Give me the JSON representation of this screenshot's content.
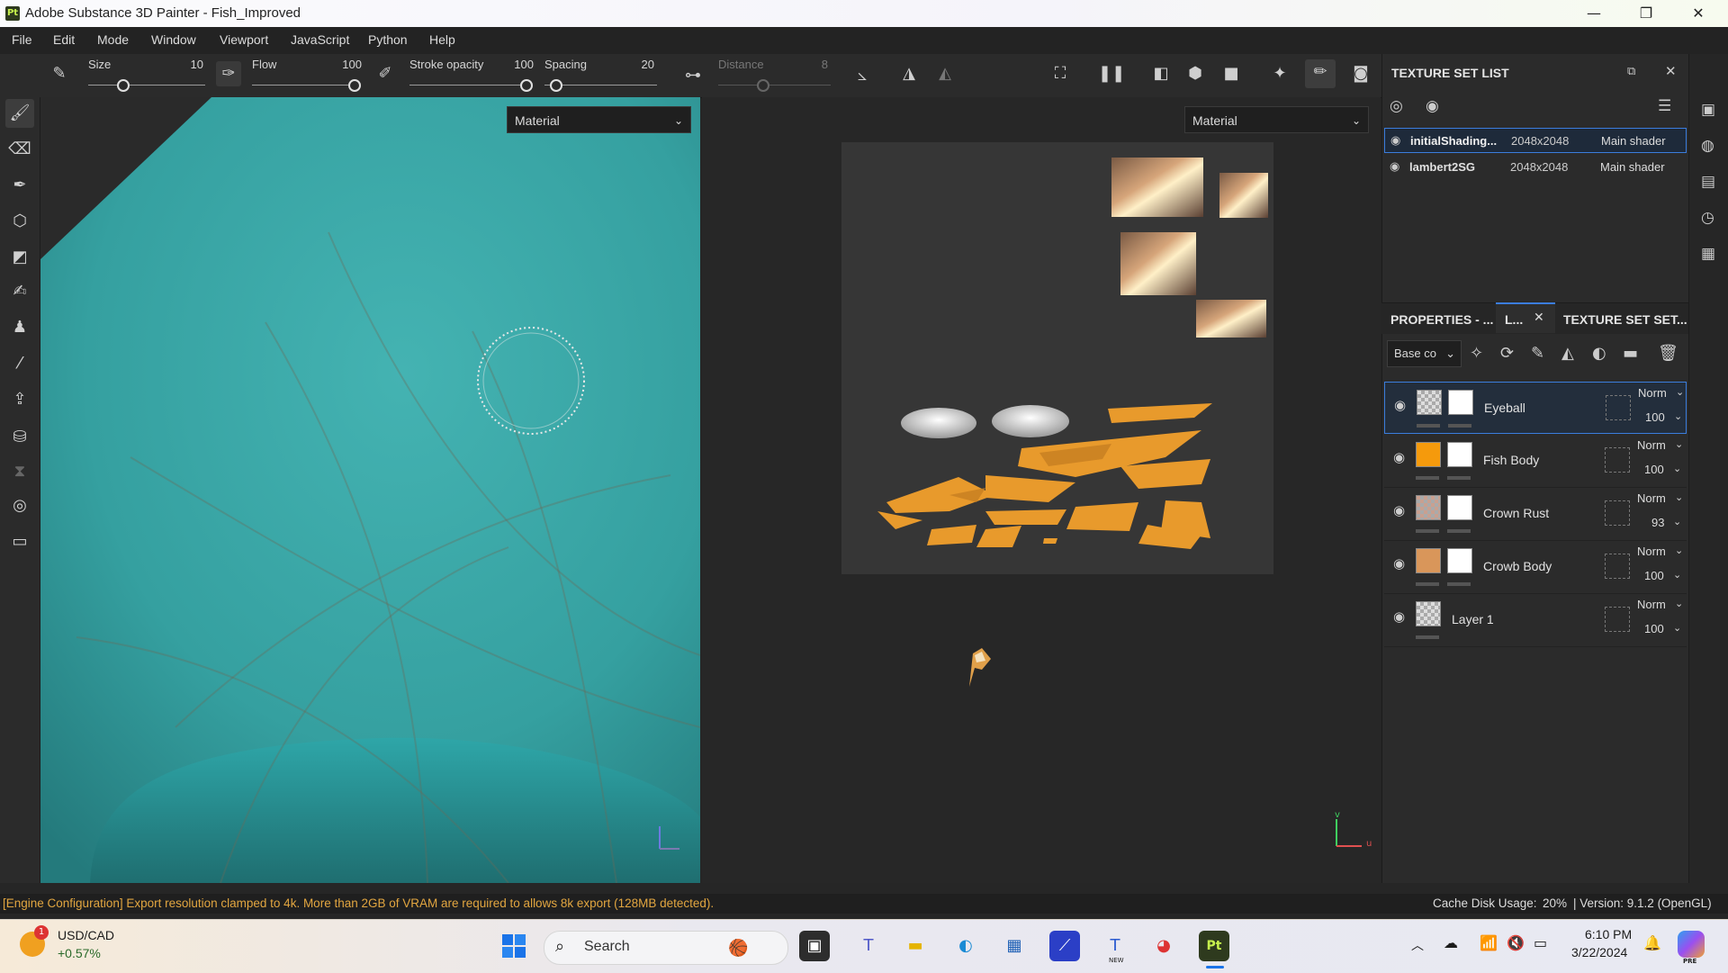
{
  "window": {
    "title": "Adobe Substance 3D Painter - Fish_Improved",
    "app_icon_text": "Pt",
    "controls": {
      "minimize": "—",
      "maximize": "❐",
      "close": "✕"
    }
  },
  "menu": [
    "File",
    "Edit",
    "Mode",
    "Window",
    "Viewport",
    "JavaScript",
    "Python",
    "Help"
  ],
  "toolbar": {
    "size": {
      "label": "Size",
      "value": "10",
      "level": 0.3
    },
    "flow": {
      "label": "Flow",
      "value": "100",
      "level": 1.0
    },
    "stroke_opacity": {
      "label": "Stroke opacity",
      "value": "100",
      "level": 1.0
    },
    "spacing": {
      "label": "Spacing",
      "value": "20",
      "level": 0.1
    },
    "distance": {
      "label": "Distance",
      "value": "8",
      "level": 0.4
    }
  },
  "viewports": {
    "left_dropdown": "Material",
    "right_dropdown": "Material",
    "axis_v": "v",
    "axis_u": "u"
  },
  "texture_set_list": {
    "title": "TEXTURE SET LIST",
    "rows": [
      {
        "name": "initialShading...",
        "size": "2048x2048",
        "shader": "Main shader",
        "selected": true
      },
      {
        "name": "lambert2SG",
        "size": "2048x2048",
        "shader": "Main shader",
        "selected": false
      }
    ]
  },
  "properties": {
    "tab_properties": "PROPERTIES - ...",
    "tab_layers": "L...",
    "tab_texture_settings": "TEXTURE SET SET...",
    "channel_select": "Base co",
    "layers": [
      {
        "name": "Eyeball",
        "blend": "Norm",
        "opacity": "100",
        "thumb": "checker",
        "selected": true
      },
      {
        "name": "Fish Body",
        "blend": "Norm",
        "opacity": "100",
        "thumb": "#f59a0c",
        "selected": false
      },
      {
        "name": "Crown Rust",
        "blend": "Norm",
        "opacity": "93",
        "thumb": "checker-rust",
        "selected": false
      },
      {
        "name": "Crowb Body",
        "blend": "Norm",
        "opacity": "100",
        "thumb": "#d9965a",
        "selected": false
      },
      {
        "name": "Layer 1",
        "blend": "Norm",
        "opacity": "100",
        "thumb": "checker",
        "selected": false
      }
    ]
  },
  "status": {
    "message": "[Engine Configuration] Export resolution clamped to 4k. More than 2GB of VRAM are required to allows 8k export (128MB detected).",
    "cache": "Cache Disk Usage:",
    "cache_value": "20%",
    "version": "| Version: 9.1.2 (OpenGL)"
  },
  "taskbar": {
    "ticker_name": "USD/CAD",
    "ticker_change": "+0.57%",
    "ticker_badge": "1",
    "search_placeholder": "Search",
    "time": "6:10 PM",
    "date": "3/22/2024",
    "new_badge": "NEW",
    "pre_badge": "PRE"
  },
  "colors": {
    "accent": "#3b7ddd",
    "teal": "#38a9a9",
    "status_text": "#e2a640"
  }
}
